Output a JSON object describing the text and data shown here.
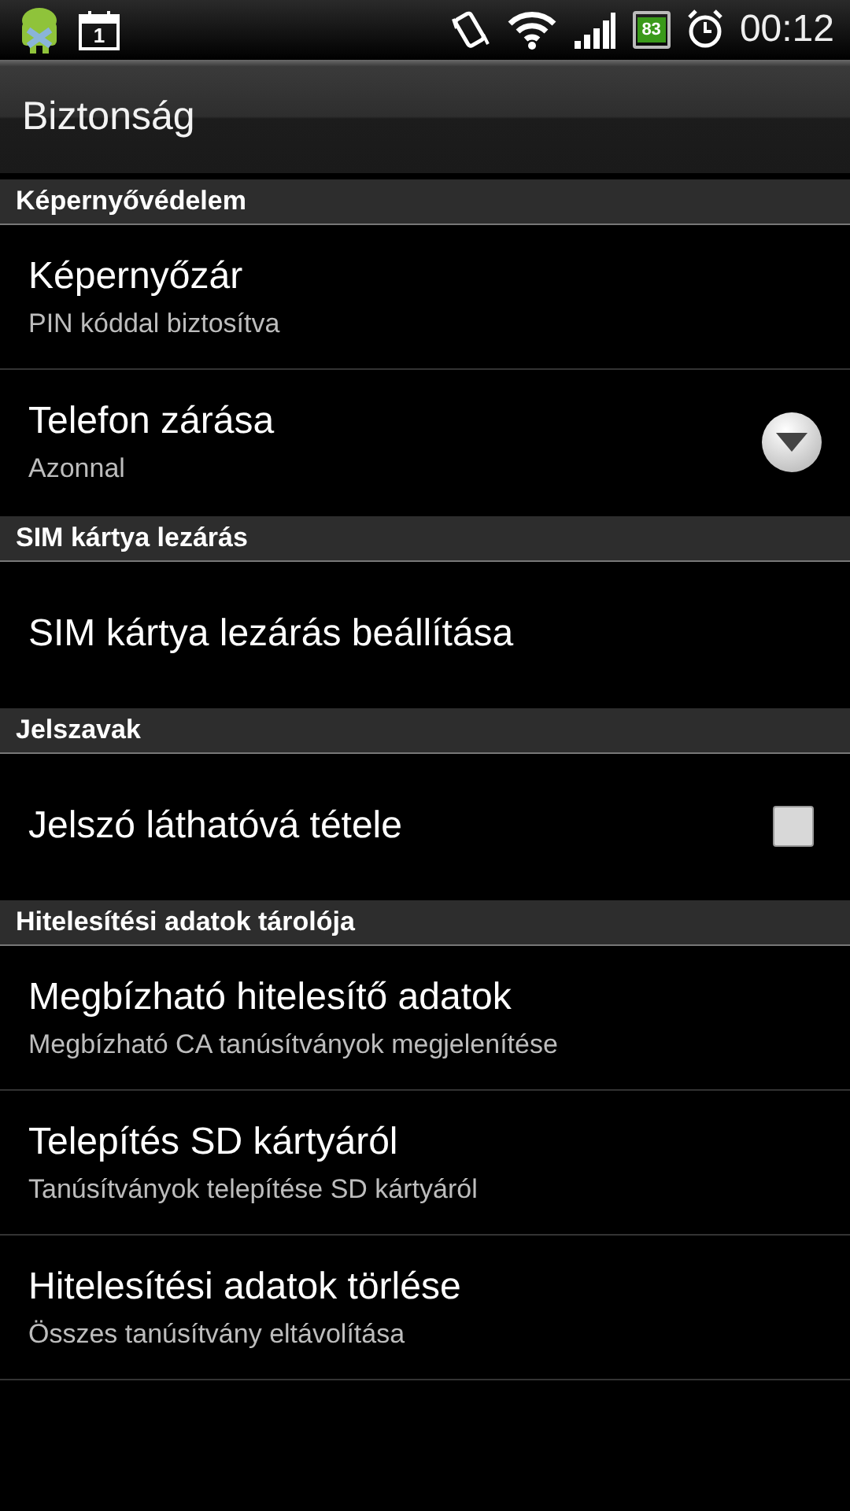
{
  "status_bar": {
    "battery": "83",
    "time": "00:12",
    "calendar_day": "1"
  },
  "title": "Biztonság",
  "sections": [
    {
      "header": "Képernyővédelem",
      "items": [
        {
          "kind": "plain",
          "title": "Képernyőzár",
          "summary": "PIN kóddal biztosítva"
        },
        {
          "kind": "dropdown",
          "title": "Telefon zárása",
          "summary": "Azonnal"
        }
      ]
    },
    {
      "header": "SIM kártya lezárás",
      "items": [
        {
          "kind": "plain",
          "title": "SIM kártya lezárás beállítása"
        }
      ]
    },
    {
      "header": "Jelszavak",
      "items": [
        {
          "kind": "checkbox",
          "title": "Jelszó láthatóvá tétele",
          "checked": false
        }
      ]
    },
    {
      "header": "Hitelesítési adatok tárolója",
      "items": [
        {
          "kind": "plain",
          "title": "Megbízható hitelesítő adatok",
          "summary": "Megbízható CA tanúsítványok megjelenítése"
        },
        {
          "kind": "plain",
          "title": "Telepítés SD kártyáról",
          "summary": "Tanúsítványok telepítése SD kártyáról"
        },
        {
          "kind": "plain",
          "title": "Hitelesítési adatok törlése",
          "summary": "Összes tanúsítvány eltávolítása"
        }
      ]
    }
  ]
}
